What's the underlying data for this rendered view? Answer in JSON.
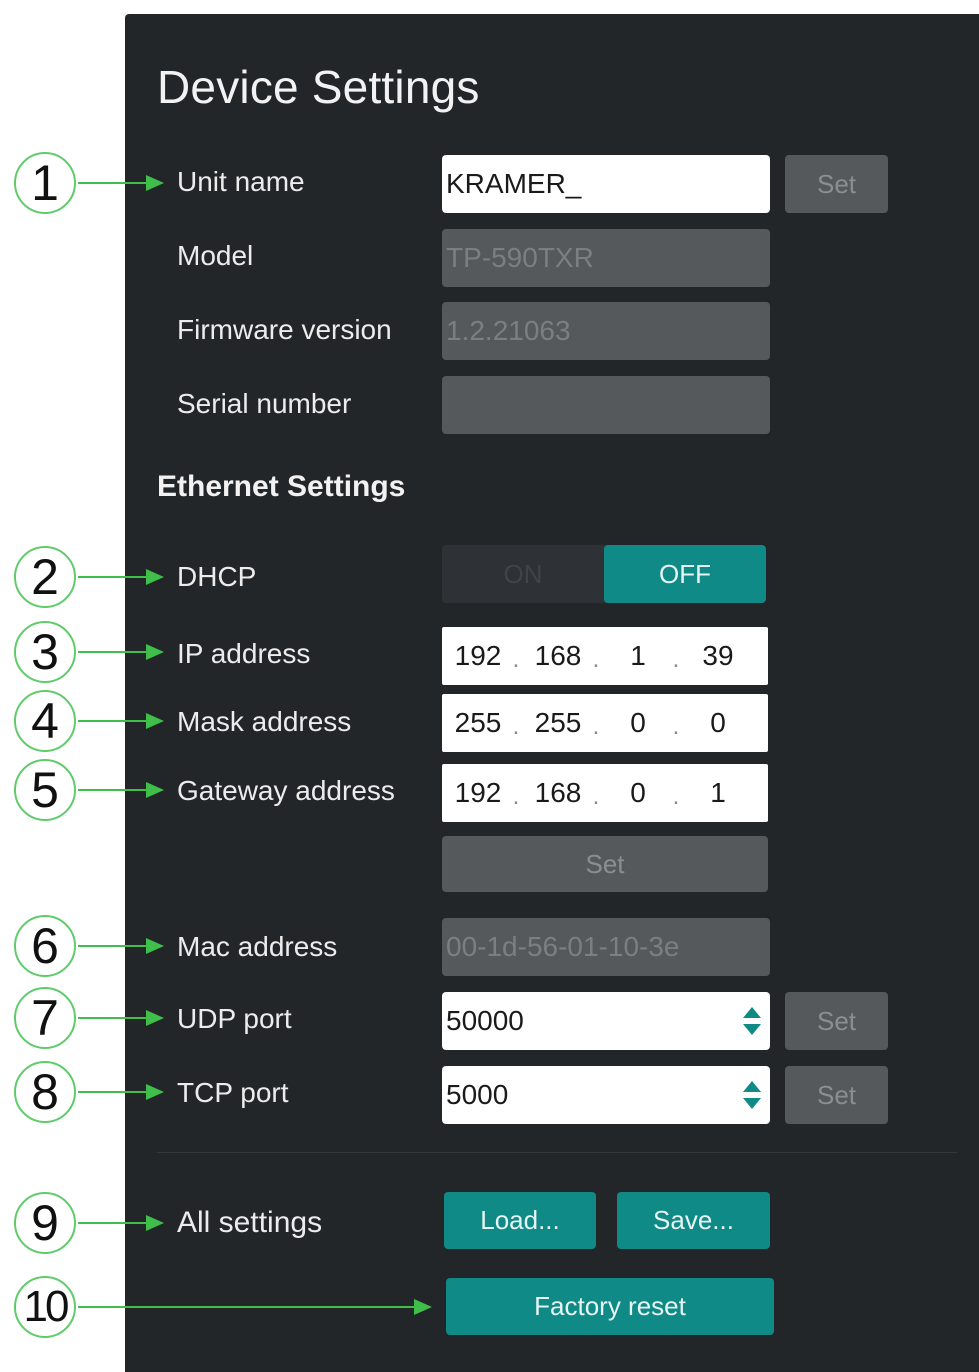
{
  "title": "Device Settings",
  "ethernet_title": "Ethernet Settings",
  "unit_name": {
    "label": "Unit name",
    "value": "KRAMER_",
    "button": "Set"
  },
  "model": {
    "label": "Model",
    "value": "TP-590TXR"
  },
  "firmware": {
    "label": "Firmware version",
    "value": "1.2.21063"
  },
  "serial": {
    "label": "Serial number",
    "value": ""
  },
  "dhcp": {
    "label": "DHCP",
    "on": "ON",
    "off": "OFF",
    "selected": "OFF"
  },
  "ip": {
    "label": "IP address",
    "octets": [
      "192",
      "168",
      "1",
      "39"
    ]
  },
  "mask": {
    "label": "Mask address",
    "octets": [
      "255",
      "255",
      "0",
      "0"
    ]
  },
  "gateway": {
    "label": "Gateway address",
    "octets": [
      "192",
      "168",
      "0",
      "1"
    ]
  },
  "network_set_button": "Set",
  "mac": {
    "label": "Mac address",
    "value": "00-1d-56-01-10-3e"
  },
  "udp": {
    "label": "UDP port",
    "value": "50000",
    "button": "Set"
  },
  "tcp": {
    "label": "TCP port",
    "value": "5000",
    "button": "Set"
  },
  "all_settings": {
    "label": "All settings",
    "load": "Load...",
    "save": "Save..."
  },
  "factory_reset": "Factory reset",
  "callouts": [
    "1",
    "2",
    "3",
    "4",
    "5",
    "6",
    "7",
    "8",
    "9",
    "10"
  ],
  "colors": {
    "panel": "#232629",
    "accent": "#0f8a86",
    "callout_ring": "#5fcb6a",
    "disabled": "#55595c"
  }
}
